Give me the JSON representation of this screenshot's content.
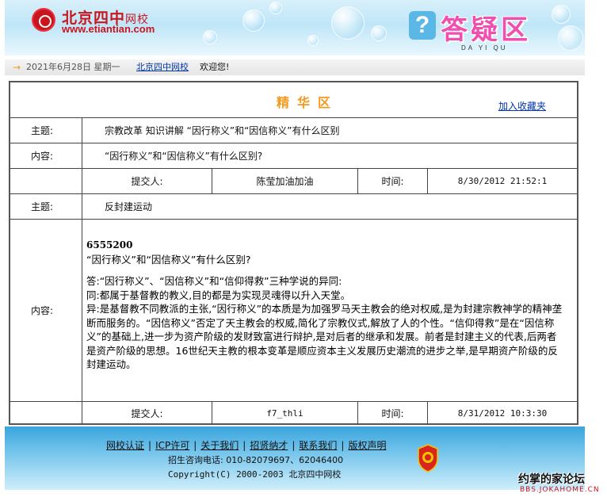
{
  "header": {
    "logo_cn": "北京四中",
    "logo_cn_small": "网校",
    "logo_url": "www.etiantian.com",
    "section_title": "答疑区",
    "section_pinyin": "DA YI QU"
  },
  "datebar": {
    "date": "2021年6月28日  星期一",
    "site_link": "北京四中网校",
    "welcome": "欢迎您!"
  },
  "jinghua": {
    "title": "精华区",
    "favorite_link": "加入收藏夹"
  },
  "post": {
    "subject_label": "主题:",
    "subject": "宗教改革  知识讲解  “因行称义”和“因信称义”有什么区别",
    "content_label": "内容:",
    "content": "“因行称义”和“因信称义”有什么区别?",
    "submitter_label": "提交人:",
    "submitter": "陈莹加油加油",
    "time_label": "时间:",
    "time": "8/30/2012 21:52:1"
  },
  "reply": {
    "subject_label": "主题:",
    "subject": "反封建运动",
    "content_label": "内容:",
    "id_number": "6555200",
    "question": "“因行称义”和“因信称义”有什么区别?",
    "answer_lines": [
      "答:“因行称义”、“因信称义”和“信仰得救”三种学说的异同:",
      "同:都属于基督教的教义,目的都是为实现灵魂得以升入天堂。",
      "异:是基督教不同教派的主张,“因行称义”的本质是为加强罗马天主教会的绝对权威,是为封建宗教神学的精神垄断而服务的。“因信称义”否定了天主教会的权威,简化了宗教仪式,解放了人的个性。“信仰得救”是在“因信称义”的基础上,进一步为资产阶级的发财致富进行辩护,是对后者的继承和发展。前者是封建主义的代表,后两者是资产阶级的思想。16世纪天主教的根本变革是顺应资本主义发展历史潮流的进步之举,是早期资产阶级的反封建运动。"
    ],
    "submitter_label": "提交人:",
    "submitter": "f7_thli",
    "time_label": "时间:",
    "time": "8/31/2012 10:3:30"
  },
  "footer": {
    "links": [
      "网校认证",
      "ICP许可",
      "关于我们",
      "招贤纳才",
      "联系我们",
      "版权声明"
    ],
    "phone": "招生咨询电话: 010-82079697、62046400",
    "copyright": "Copyright(C) 2000-2003 北京四中网校"
  },
  "watermark": {
    "text": "约掌的家论坛",
    "sub": "BBS.JOKAHOME.CN"
  },
  "colors": {
    "accent_orange": "#f39a1d",
    "link_blue": "#0036a8",
    "brand_red": "#c9151e",
    "title_pink": "#f14fb0"
  }
}
